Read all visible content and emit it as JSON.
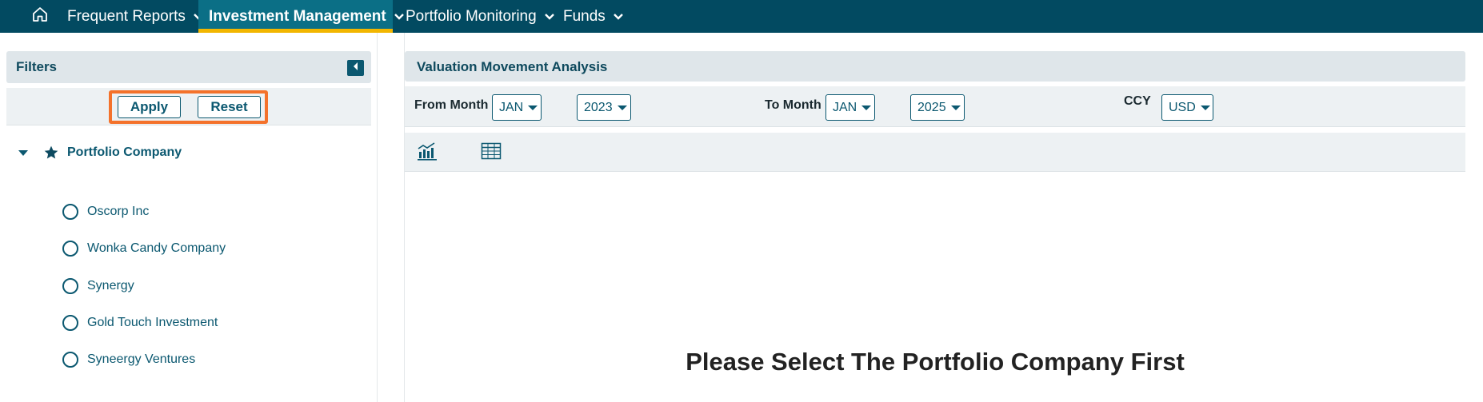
{
  "nav": {
    "home_icon": "home-icon",
    "items": [
      {
        "label": "Frequent Reports",
        "active": false
      },
      {
        "label": "Investment Management",
        "active": true
      },
      {
        "label": "Portfolio Monitoring",
        "active": false
      },
      {
        "label": "Funds",
        "active": false
      }
    ],
    "colors": {
      "bar": "#024a61",
      "active": "#0b6f86",
      "active_underline": "#f2b600"
    }
  },
  "filters": {
    "title": "Filters",
    "apply_label": "Apply",
    "reset_label": "Reset",
    "highlight_color": "#f4722b",
    "tree": {
      "root_label": "Portfolio Company",
      "items": [
        {
          "label": "Oscorp Inc",
          "selected": false
        },
        {
          "label": "Wonka Candy Company",
          "selected": false
        },
        {
          "label": "Synergy",
          "selected": false
        },
        {
          "label": "Gold Touch Investment",
          "selected": false
        },
        {
          "label": "Syneergy Ventures",
          "selected": false
        }
      ]
    }
  },
  "main": {
    "title": "Valuation Movement Analysis",
    "from_month_label": "From Month",
    "from_month": "JAN",
    "from_year": "2023",
    "to_month_label": "To Month",
    "to_month": "JAN",
    "to_year": "2025",
    "ccy_label": "CCY",
    "ccy": "USD",
    "views": [
      "chart-icon",
      "table-icon"
    ],
    "empty_message": "Please Select The Portfolio Company First"
  }
}
